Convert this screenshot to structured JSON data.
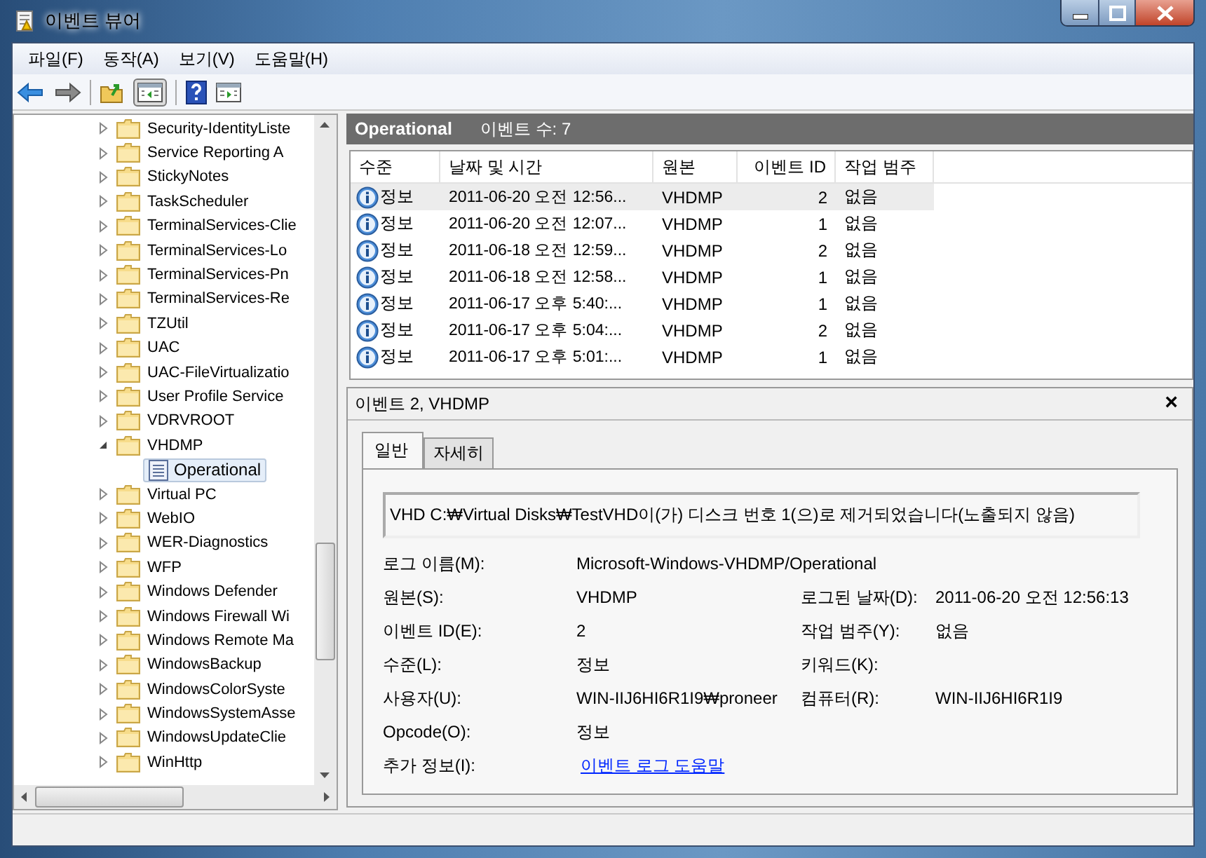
{
  "window": {
    "title": "이벤트 뷰어"
  },
  "menu": [
    "파일(F)",
    "동작(A)",
    "보기(V)",
    "도움말(H)"
  ],
  "tree": {
    "items": [
      {
        "label": "Security-IdentityListe",
        "expanded": false,
        "selected": false
      },
      {
        "label": "Service Reporting A",
        "expanded": false,
        "selected": false
      },
      {
        "label": "StickyNotes",
        "expanded": false,
        "selected": false
      },
      {
        "label": "TaskScheduler",
        "expanded": false,
        "selected": false
      },
      {
        "label": "TerminalServices-Clie",
        "expanded": false,
        "selected": false
      },
      {
        "label": "TerminalServices-Lo",
        "expanded": false,
        "selected": false
      },
      {
        "label": "TerminalServices-Pn",
        "expanded": false,
        "selected": false
      },
      {
        "label": "TerminalServices-Re",
        "expanded": false,
        "selected": false
      },
      {
        "label": "TZUtil",
        "expanded": false,
        "selected": false
      },
      {
        "label": "UAC",
        "expanded": false,
        "selected": false
      },
      {
        "label": "UAC-FileVirtualizatio",
        "expanded": false,
        "selected": false
      },
      {
        "label": "User Profile Service",
        "expanded": false,
        "selected": false
      },
      {
        "label": "VDRVROOT",
        "expanded": false,
        "selected": false
      },
      {
        "label": "VHDMP",
        "expanded": true,
        "selected": false,
        "children": [
          {
            "label": "Operational",
            "selected": true
          }
        ]
      },
      {
        "label": "Virtual PC",
        "expanded": false,
        "selected": false
      },
      {
        "label": "WebIO",
        "expanded": false,
        "selected": false
      },
      {
        "label": "WER-Diagnostics",
        "expanded": false,
        "selected": false
      },
      {
        "label": "WFP",
        "expanded": false,
        "selected": false
      },
      {
        "label": "Windows Defender",
        "expanded": false,
        "selected": false
      },
      {
        "label": "Windows Firewall Wi",
        "expanded": false,
        "selected": false
      },
      {
        "label": "Windows Remote Ma",
        "expanded": false,
        "selected": false
      },
      {
        "label": "WindowsBackup",
        "expanded": false,
        "selected": false
      },
      {
        "label": "WindowsColorSyste",
        "expanded": false,
        "selected": false
      },
      {
        "label": "WindowsSystemAsse",
        "expanded": false,
        "selected": false
      },
      {
        "label": "WindowsUpdateClie",
        "expanded": false,
        "selected": false
      },
      {
        "label": "WinHttp",
        "expanded": false,
        "selected": false
      }
    ]
  },
  "log_header": {
    "name": "Operational",
    "count": "이벤트 수: 7"
  },
  "table": {
    "columns": [
      "수준",
      "날짜 및 시간",
      "원본",
      "이벤트 ID",
      "작업 범주"
    ],
    "rows": [
      {
        "level": "정보",
        "date": "2011-06-20 오전 12:56...",
        "source": "VHDMP",
        "id": "2",
        "category": "없음",
        "selected": true
      },
      {
        "level": "정보",
        "date": "2011-06-20 오전 12:07...",
        "source": "VHDMP",
        "id": "1",
        "category": "없음",
        "selected": false
      },
      {
        "level": "정보",
        "date": "2011-06-18 오전 12:59...",
        "source": "VHDMP",
        "id": "2",
        "category": "없음",
        "selected": false
      },
      {
        "level": "정보",
        "date": "2011-06-18 오전 12:58...",
        "source": "VHDMP",
        "id": "1",
        "category": "없음",
        "selected": false
      },
      {
        "level": "정보",
        "date": "2011-06-17 오후 5:40:...",
        "source": "VHDMP",
        "id": "1",
        "category": "없음",
        "selected": false
      },
      {
        "level": "정보",
        "date": "2011-06-17 오후 5:04:...",
        "source": "VHDMP",
        "id": "2",
        "category": "없음",
        "selected": false
      },
      {
        "level": "정보",
        "date": "2011-06-17 오후 5:01:...",
        "source": "VHDMP",
        "id": "1",
        "category": "없음",
        "selected": false
      }
    ]
  },
  "detail": {
    "title": "이벤트 2, VHDMP",
    "close": "×",
    "tabs": [
      {
        "label": "일반",
        "selected": true
      },
      {
        "label": "자세히",
        "selected": false
      }
    ],
    "message": "VHD C:₩Virtual Disks₩TestVHD이(가) 디스크 번호 1(으)로 제거되었습니다(노출되지 않음)",
    "rows": [
      {
        "left": {
          "label": "로그 이름(M):",
          "value": "Microsoft-Windows-VHDMP/Operational"
        }
      },
      {
        "left": {
          "label": "원본(S):",
          "value": "VHDMP"
        },
        "right": {
          "label": "로그된 날짜(D):",
          "value": "2011-06-20 오전 12:56:13"
        }
      },
      {
        "left": {
          "label": "이벤트 ID(E):",
          "value": "2"
        },
        "right": {
          "label": "작업 범주(Y):",
          "value": "없음"
        }
      },
      {
        "left": {
          "label": "수준(L):",
          "value": "정보"
        },
        "right": {
          "label": "키워드(K):"
        }
      },
      {
        "left": {
          "label": "사용자(U):",
          "value": "WIN-IIJ6HI6R1I9₩proneer"
        },
        "right": {
          "label": "컴퓨터(R):",
          "value": "WIN-IIJ6HI6R1I9"
        }
      },
      {
        "left": {
          "label": "Opcode(O):",
          "value": "정보"
        }
      },
      {
        "left": {
          "label": "추가 정보(I):",
          "value": "이벤트 로그 도움말",
          "kind": "link"
        }
      }
    ]
  }
}
